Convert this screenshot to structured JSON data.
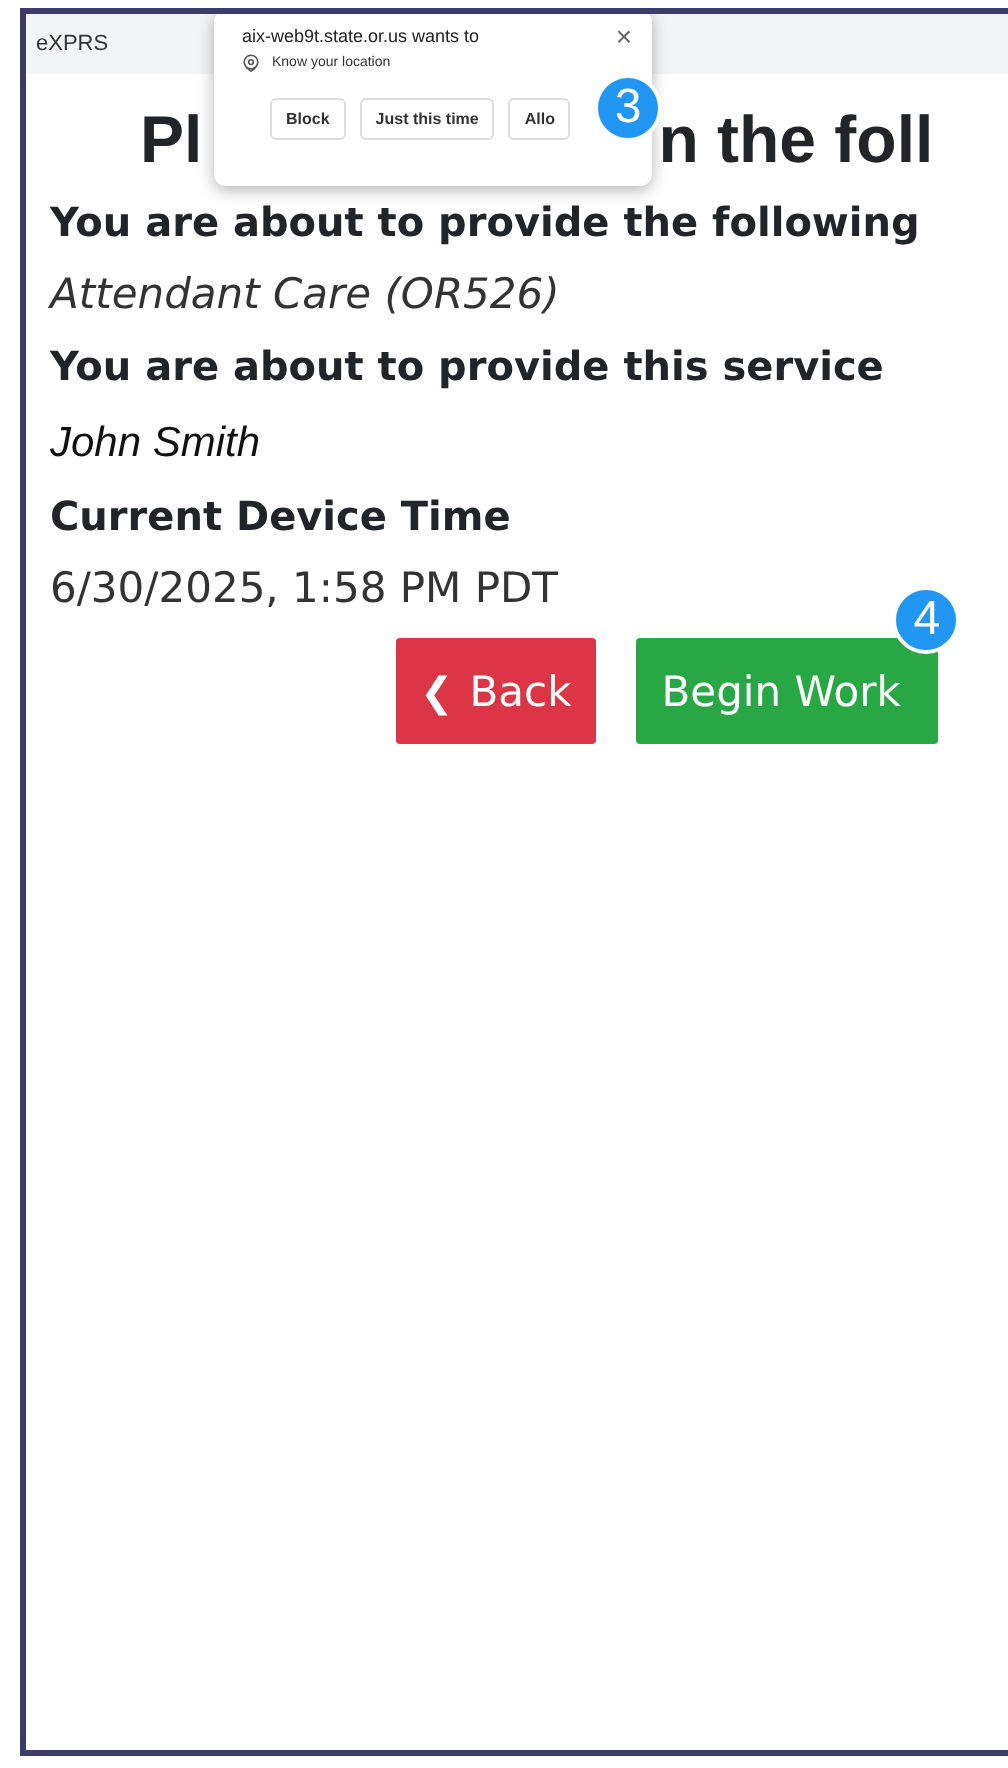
{
  "app": {
    "title": "eXPRS"
  },
  "heading": {
    "visible_parts": [
      "Pl",
      "n the foll"
    ]
  },
  "content": [
    {
      "kind": "label",
      "text": "You are about to provide the following"
    },
    {
      "kind": "value",
      "text": "Attendant Care (OR526)"
    },
    {
      "kind": "label",
      "text": "You are about to provide this service"
    },
    {
      "kind": "name",
      "text": "John Smith"
    },
    {
      "kind": "label",
      "text": "Current Device Time"
    },
    {
      "kind": "time",
      "text": "6/30/2025, 1:58 PM PDT"
    }
  ],
  "buttons": [
    {
      "kind": "back",
      "icon": "❮",
      "label": "Back"
    },
    {
      "kind": "primary",
      "label": "Begin Work",
      "badge": "4"
    }
  ],
  "permission_popup": {
    "title": "aix-web9t.state.or.us wants to",
    "close": "×",
    "request": "Know your location",
    "buttons": [
      "Block",
      "Just this time",
      "Allo"
    ],
    "badge": "3"
  }
}
